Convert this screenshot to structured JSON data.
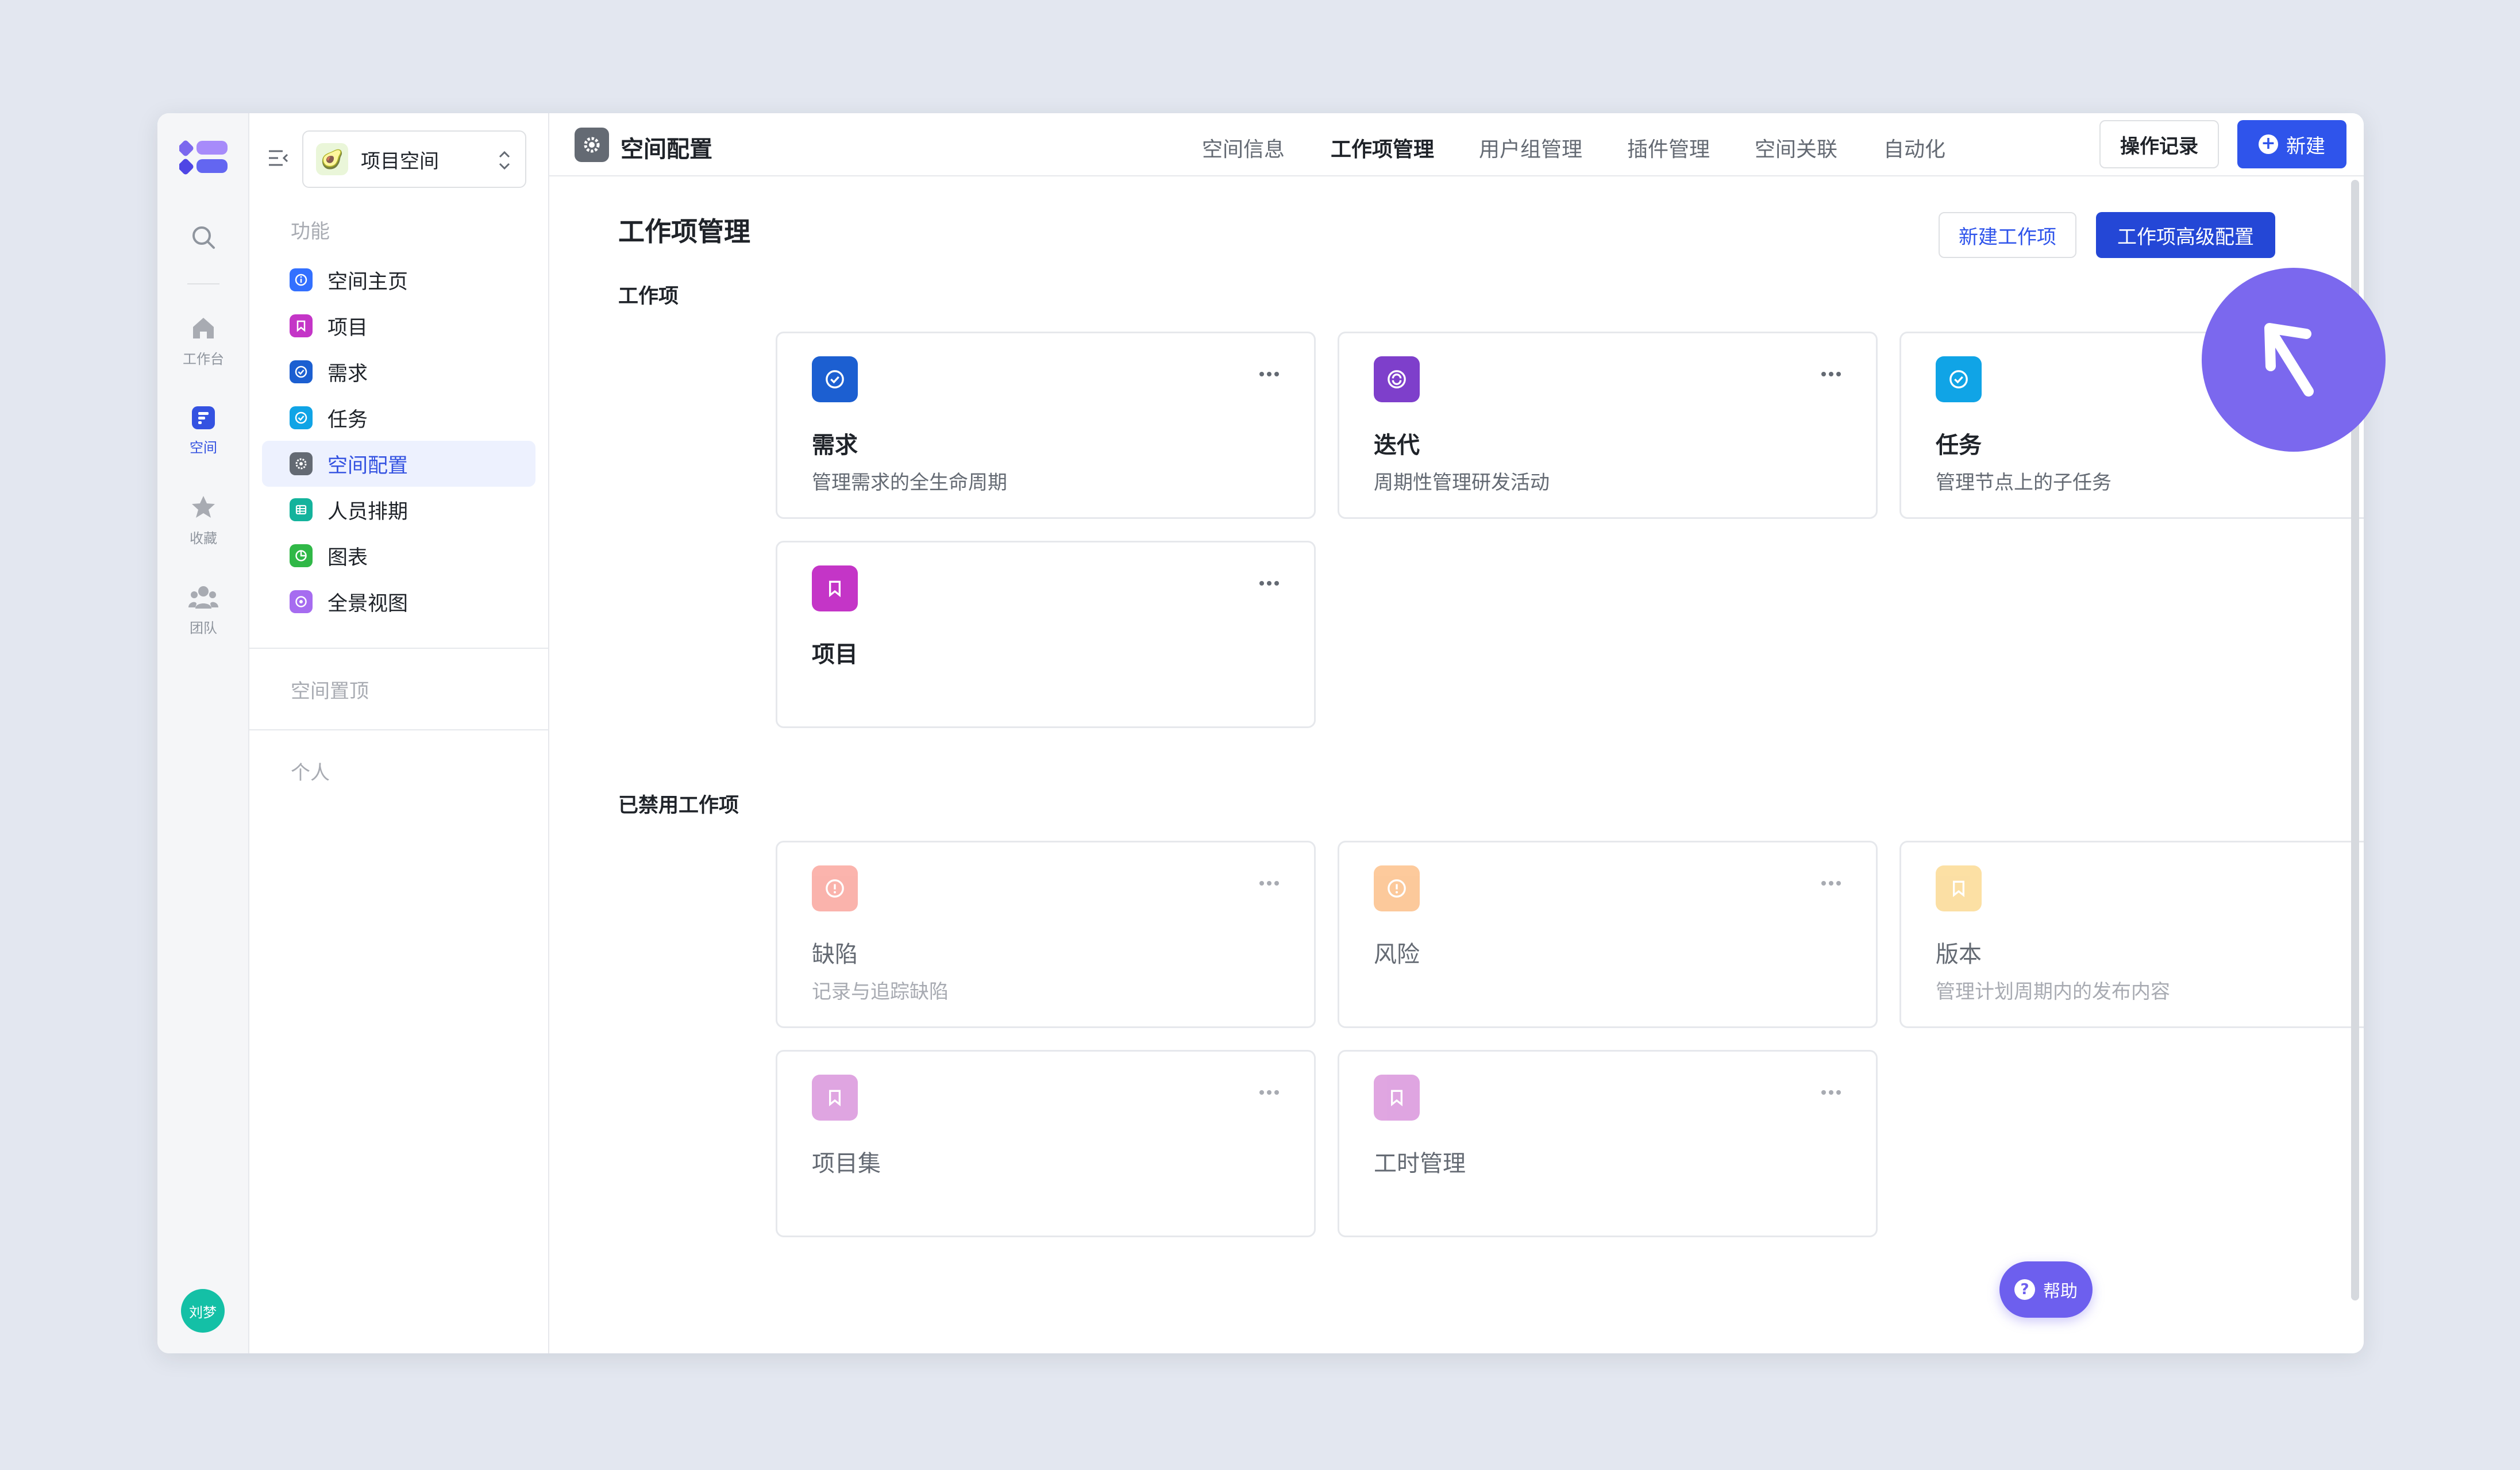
{
  "rail": {
    "items": [
      {
        "label": "工作台"
      },
      {
        "label": "空间"
      },
      {
        "label": "收藏"
      },
      {
        "label": "团队"
      }
    ],
    "avatar": "刘梦"
  },
  "sidebar": {
    "space_name": "项目空间",
    "section_features": "功能",
    "items": [
      {
        "label": "空间主页",
        "color": "#3370FF"
      },
      {
        "label": "项目",
        "color": "#C435C7"
      },
      {
        "label": "需求",
        "color": "#1C5FD1"
      },
      {
        "label": "任务",
        "color": "#10A4E6"
      },
      {
        "label": "空间配置",
        "color": "#646A73"
      },
      {
        "label": "人员排期",
        "color": "#14B39C"
      },
      {
        "label": "图表",
        "color": "#30B847"
      },
      {
        "label": "全景视图",
        "color": "#A66CF0"
      }
    ],
    "section_pinned": "空间置顶",
    "section_personal": "个人"
  },
  "topbar": {
    "title": "空间配置",
    "tabs": [
      "空间信息",
      "工作项管理",
      "用户组管理",
      "插件管理",
      "空间关联",
      "自动化"
    ],
    "active_tab": "工作项管理",
    "log_button": "操作记录",
    "new_button": "新建"
  },
  "page": {
    "title": "工作项管理",
    "new_item_button": "新建工作项",
    "advanced_button": "工作项高级配置",
    "group_active": "工作项",
    "group_disabled": "已禁用工作项"
  },
  "cards_active": [
    {
      "title": "需求",
      "desc": "管理需求的全生命周期",
      "color": "#1C5FD1",
      "icon": "check-circle-icon"
    },
    {
      "title": "迭代",
      "desc": "周期性管理研发活动",
      "color": "#7E3FCB",
      "icon": "cycle-icon"
    },
    {
      "title": "任务",
      "desc": "管理节点上的子任务",
      "color": "#10A4E6",
      "icon": "check-circle-icon"
    },
    {
      "title": "项目",
      "desc": "",
      "color": "#C435C7",
      "icon": "bookmark-icon"
    }
  ],
  "cards_disabled": [
    {
      "title": "缺陷",
      "desc": "记录与追踪缺陷",
      "color": "#F7766A",
      "icon": "alert-icon"
    },
    {
      "title": "风险",
      "desc": "",
      "color": "#FB9E4A",
      "icon": "alert-icon"
    },
    {
      "title": "版本",
      "desc": "管理计划周期内的发布内容",
      "color": "#F9C65A",
      "icon": "bookmark-icon"
    },
    {
      "title": "项目集",
      "desc": "",
      "color": "#C65CC9",
      "icon": "bookmark-icon"
    },
    {
      "title": "工时管理",
      "desc": "",
      "color": "#C65CC9",
      "icon": "bookmark-icon"
    }
  ],
  "help_button": "帮助"
}
